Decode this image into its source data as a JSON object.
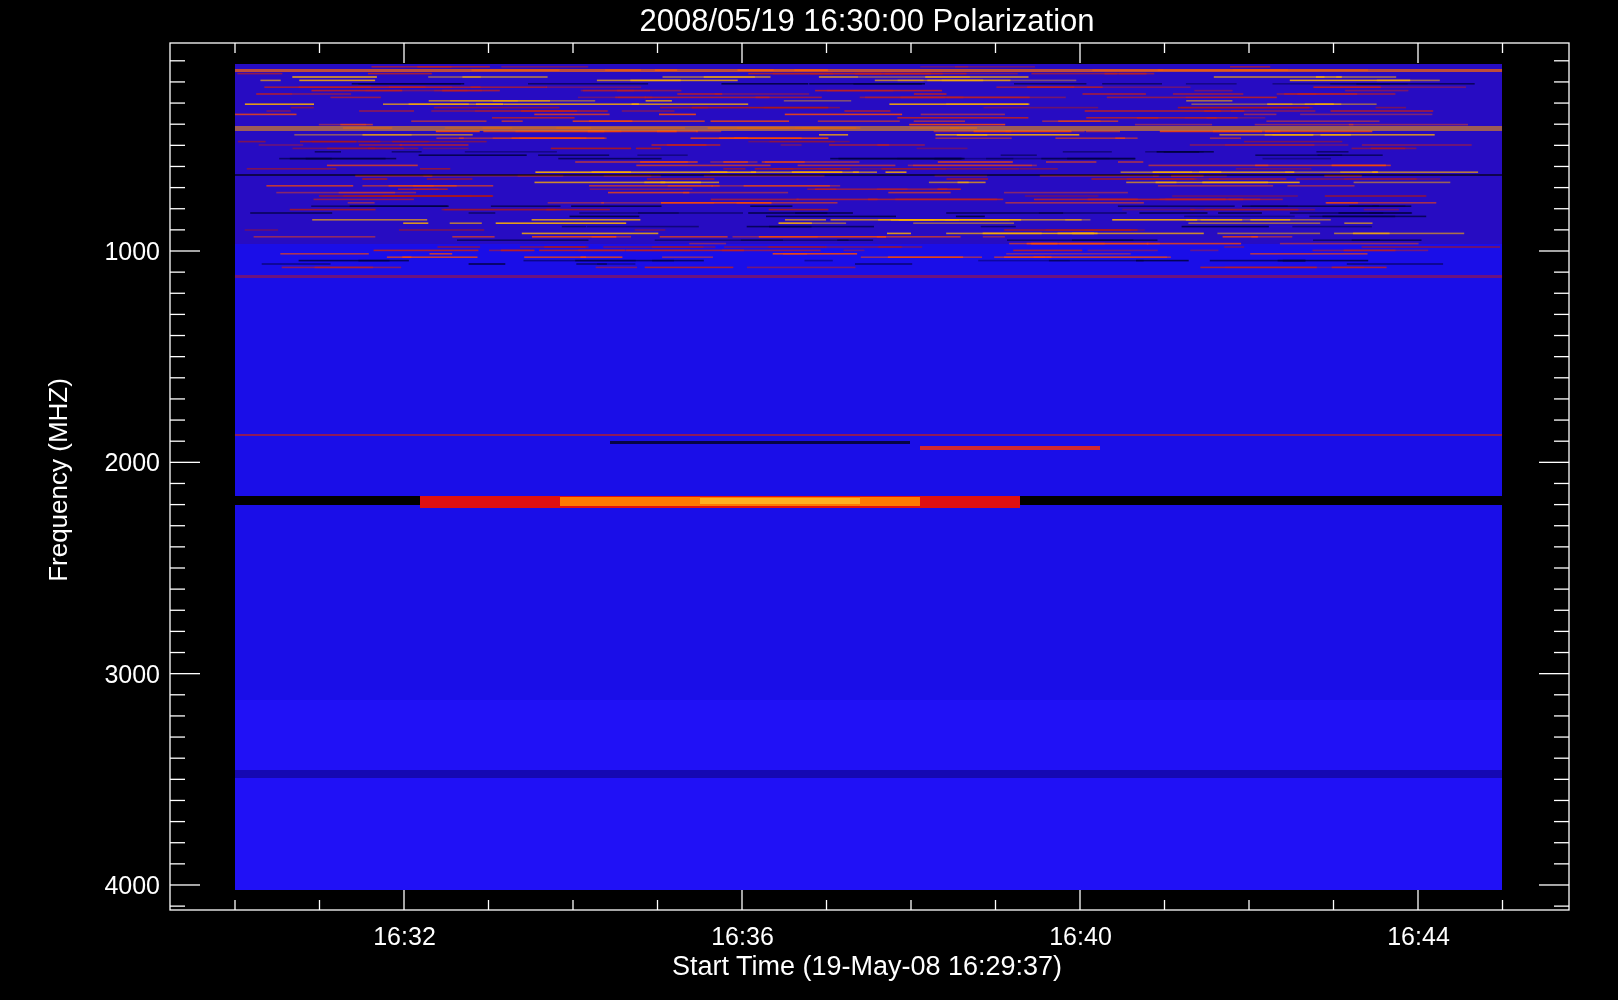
{
  "plot": {
    "title": "2008/05/19 16:30:00 Polarization",
    "ylabel": "Frequency (MHZ)",
    "xlabel": "Start Time (19-May-08 16:29:37)",
    "y_tick_labels": [
      "1000",
      "2000",
      "3000",
      "4000"
    ],
    "x_tick_labels": [
      "16:32",
      "16:36",
      "16:40",
      "16:44"
    ]
  }
}
